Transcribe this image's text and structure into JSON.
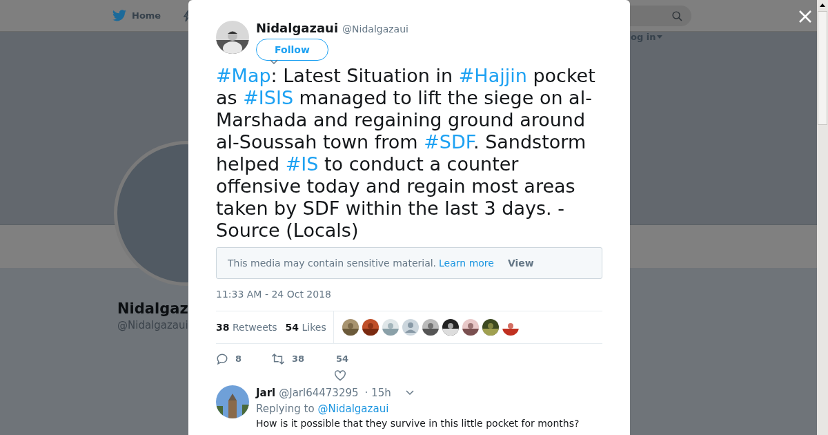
{
  "background_page": {
    "nav": [
      {
        "label": "Home",
        "kind": "home"
      }
    ],
    "login": "og in",
    "profile_name": "Nidalgaz",
    "profile_handle": "@Nidalgazaui"
  },
  "tweet": {
    "author_name": "Nidalgazaui",
    "author_handle": "@Nidalgazaui",
    "follow_button": "Follow",
    "text": [
      {
        "kind": "hashtag",
        "text": "#Map"
      },
      {
        "kind": "text",
        "text": ": Latest Situation in "
      },
      {
        "kind": "hashtag",
        "text": "#Hajjin"
      },
      {
        "kind": "text",
        "text": " pocket as "
      },
      {
        "kind": "hashtag",
        "text": "#ISIS"
      },
      {
        "kind": "text",
        "text": " managed to lift the siege on al-Marshada and regaining ground around al-Soussah town from "
      },
      {
        "kind": "hashtag",
        "text": "#SDF"
      },
      {
        "kind": "text",
        "text": ". Sandstorm helped "
      },
      {
        "kind": "hashtag",
        "text": "#IS"
      },
      {
        "kind": "text",
        "text": " to conduct a counter offensive today and regain most areas taken by SDF within the last 3 days. - Source (Locals)"
      }
    ],
    "sensitive_notice": {
      "message": "This media may contain sensitive material.",
      "link": "Learn more",
      "button": "View"
    },
    "timestamp": "11:33 AM - 24 Oct 2018",
    "stats": [
      {
        "count": "38",
        "label": "Retweets"
      },
      {
        "count": "54",
        "label": "Likes"
      }
    ],
    "likers": [
      {
        "kind": "picture"
      },
      {
        "kind": "picture"
      },
      {
        "kind": "picture"
      },
      {
        "kind": "default"
      },
      {
        "kind": "picture"
      },
      {
        "kind": "picture"
      },
      {
        "kind": "picture"
      },
      {
        "kind": "picture"
      },
      {
        "kind": "picture"
      }
    ],
    "actions": [
      {
        "kind": "reply",
        "count": "8"
      },
      {
        "kind": "retweet",
        "count": "38"
      },
      {
        "kind": "like",
        "count": "54"
      }
    ]
  },
  "reply": {
    "name": "Jarl",
    "handle": "@Jarl64473295",
    "time": "· 15h",
    "replying_label": "Replying to",
    "replying_to": "@Nidalgazaui",
    "text": "How is it possible that they survive in this little pocket for months?"
  }
}
